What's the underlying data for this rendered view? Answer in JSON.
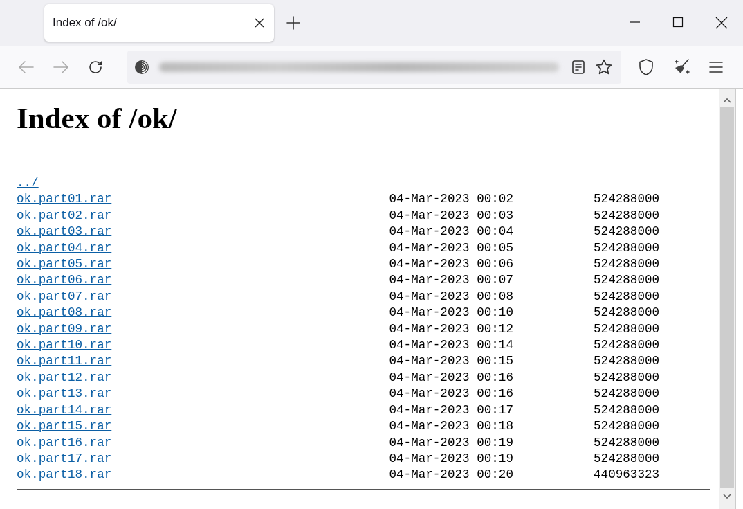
{
  "tabs": [
    {
      "title": "Index of /ok/",
      "selected": true
    }
  ],
  "page": {
    "heading": "Index of /ok/",
    "parent_link": "../",
    "entries": [
      {
        "name": "ok.part01.rar",
        "date": "04-Mar-2023 00:02",
        "size": "524288000"
      },
      {
        "name": "ok.part02.rar",
        "date": "04-Mar-2023 00:03",
        "size": "524288000"
      },
      {
        "name": "ok.part03.rar",
        "date": "04-Mar-2023 00:04",
        "size": "524288000"
      },
      {
        "name": "ok.part04.rar",
        "date": "04-Mar-2023 00:05",
        "size": "524288000"
      },
      {
        "name": "ok.part05.rar",
        "date": "04-Mar-2023 00:06",
        "size": "524288000"
      },
      {
        "name": "ok.part06.rar",
        "date": "04-Mar-2023 00:07",
        "size": "524288000"
      },
      {
        "name": "ok.part07.rar",
        "date": "04-Mar-2023 00:08",
        "size": "524288000"
      },
      {
        "name": "ok.part08.rar",
        "date": "04-Mar-2023 00:10",
        "size": "524288000"
      },
      {
        "name": "ok.part09.rar",
        "date": "04-Mar-2023 00:12",
        "size": "524288000"
      },
      {
        "name": "ok.part10.rar",
        "date": "04-Mar-2023 00:14",
        "size": "524288000"
      },
      {
        "name": "ok.part11.rar",
        "date": "04-Mar-2023 00:15",
        "size": "524288000"
      },
      {
        "name": "ok.part12.rar",
        "date": "04-Mar-2023 00:16",
        "size": "524288000"
      },
      {
        "name": "ok.part13.rar",
        "date": "04-Mar-2023 00:16",
        "size": "524288000"
      },
      {
        "name": "ok.part14.rar",
        "date": "04-Mar-2023 00:17",
        "size": "524288000"
      },
      {
        "name": "ok.part15.rar",
        "date": "04-Mar-2023 00:18",
        "size": "524288000"
      },
      {
        "name": "ok.part16.rar",
        "date": "04-Mar-2023 00:19",
        "size": "524288000"
      },
      {
        "name": "ok.part17.rar",
        "date": "04-Mar-2023 00:19",
        "size": "524288000"
      },
      {
        "name": "ok.part18.rar",
        "date": "04-Mar-2023 00:20",
        "size": "440963323"
      }
    ]
  }
}
